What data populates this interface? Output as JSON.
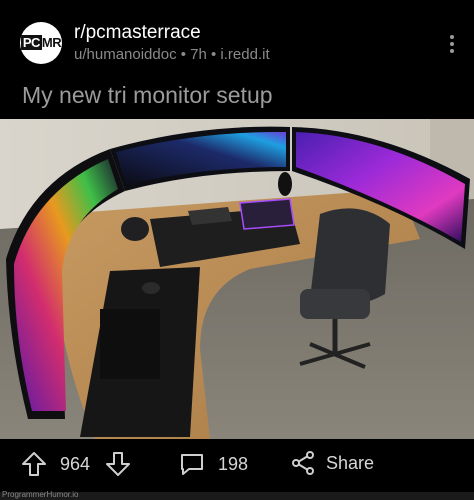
{
  "post": {
    "avatar_text_a": "PC",
    "avatar_text_b": "MR",
    "subreddit": "r/pcmasterrace",
    "meta": "u/humanoiddoc • 7h • i.redd.it",
    "title": "My new tri monitor setup"
  },
  "actions": {
    "upvotes": "964",
    "comments": "198",
    "share_label": "Share"
  },
  "watermark": "ProgrammerHumor.io",
  "icons": {
    "menu": "more-vertical-icon",
    "upvote": "arrow-up-icon",
    "downvote": "arrow-down-icon",
    "comment": "comment-icon",
    "share": "share-icon"
  },
  "colors": {
    "background": "#000000",
    "text_muted": "#8a8a8a",
    "title": "#9b9b9b"
  }
}
